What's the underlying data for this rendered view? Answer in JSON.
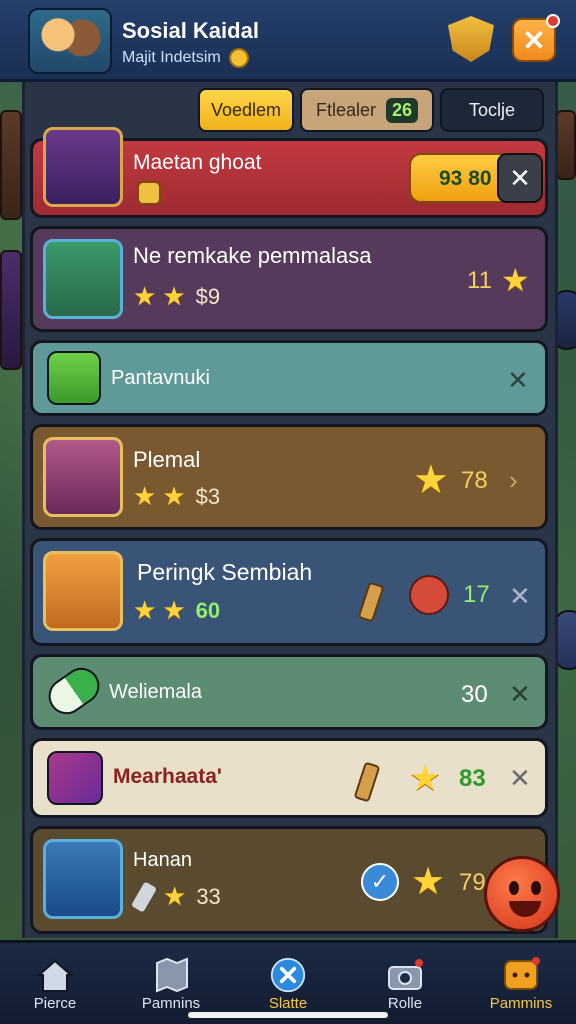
{
  "header": {
    "title": "Sosial Kaidal",
    "subtitle": "Majit Indetsim"
  },
  "tabs": [
    {
      "label": "Voedlem"
    },
    {
      "label": "Ftlealer",
      "count": "26"
    },
    {
      "label": "Toclje"
    }
  ],
  "rows": [
    {
      "title": "Maetan ghoat",
      "value": "93 80"
    },
    {
      "title": "Ne remkake pemmalasa",
      "money": "$9",
      "value": "11"
    },
    {
      "title": "Pantavnuki"
    },
    {
      "title": "Plemal",
      "money": "$3",
      "value": "78"
    },
    {
      "title": "Peringk Sembiah",
      "money": "60",
      "value": "17"
    },
    {
      "title": "Weliemala",
      "value": "30"
    },
    {
      "title": "Mearhaata'",
      "value": "83"
    },
    {
      "title": "Hanan",
      "money": "33",
      "value": "79"
    }
  ],
  "nav": [
    {
      "label": "Pierce",
      "icon": "home-icon"
    },
    {
      "label": "Pamnins",
      "icon": "map-icon"
    },
    {
      "label": "Slatte",
      "icon": "close-circle-icon"
    },
    {
      "label": "Rolle",
      "icon": "camera-icon"
    },
    {
      "label": "Pammins",
      "icon": "chat-icon"
    }
  ],
  "colors": {
    "row1": "#b8343a",
    "row2": "#5a3a5e",
    "row3": "#5f9a98",
    "row4": "#7a5830",
    "row5": "#3a5478",
    "row6": "#5c8c72",
    "row7": "#e9e0cc",
    "row8": "#5a4a30",
    "accent": "#f0b21b"
  }
}
